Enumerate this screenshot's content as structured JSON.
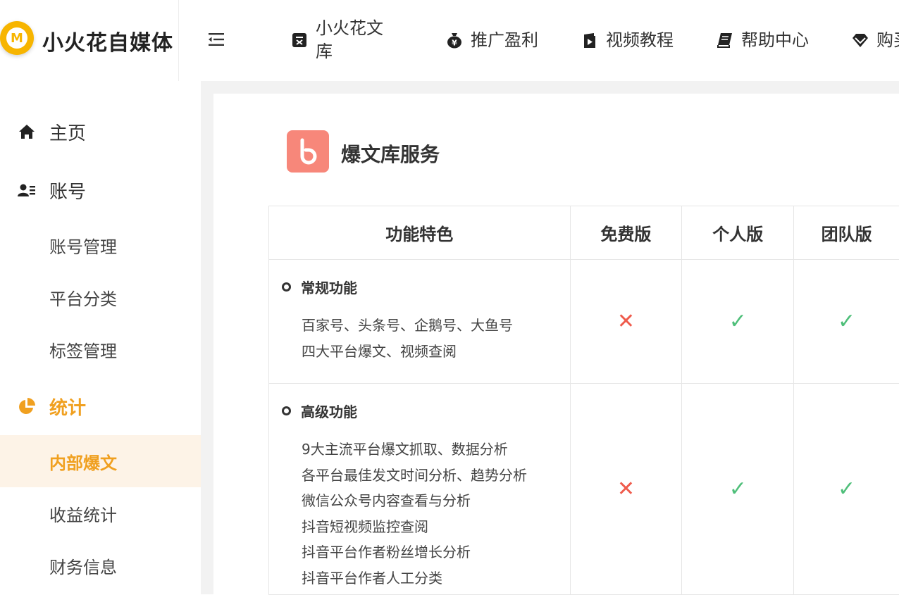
{
  "brand": {
    "name": "小火花自媒体",
    "logo_letter": "M",
    "accent": "#f7b500"
  },
  "top_nav": [
    {
      "label": "小火花文库",
      "icon": "document-icon"
    },
    {
      "label": "推广盈利",
      "icon": "money-bag-icon"
    },
    {
      "label": "视频教程",
      "icon": "video-book-icon"
    },
    {
      "label": "帮助中心",
      "icon": "book-icon"
    },
    {
      "label": "购买会员",
      "icon": "diamond-icon"
    }
  ],
  "sidebar": {
    "home": {
      "label": "主页"
    },
    "account": {
      "label": "账号"
    },
    "account_items": [
      "账号管理",
      "平台分类",
      "标签管理"
    ],
    "stats": {
      "label": "统计"
    },
    "stats_items": [
      "内部爆文",
      "收益统计",
      "财务信息"
    ],
    "active_item": "内部爆文",
    "accent": "#f0a020"
  },
  "service": {
    "title": "爆文库服务",
    "logo_letter": "b",
    "logo_color": "#f7877a"
  },
  "feature_table": {
    "headers": {
      "feature": "功能特色",
      "free": "免费版",
      "personal": "个人版",
      "team": "团队版"
    },
    "rows": [
      {
        "title": "常规功能",
        "lines": [
          "百家号、头条号、企鹅号、大鱼号",
          "四大平台爆文、视频查阅"
        ],
        "free": "✕",
        "personal": "✓",
        "team": "✓"
      },
      {
        "title": "高级功能",
        "lines": [
          "9大主流平台爆文抓取、数据分析",
          "各平台最佳发文时间分析、趋势分析",
          "微信公众号内容查看与分析",
          "抖音短视频监控查阅",
          "抖音平台作者粉丝增长分析",
          "抖音平台作者人工分类"
        ],
        "free": "✕",
        "personal": "✓",
        "team": "✓"
      }
    ]
  },
  "colors": {
    "yes": "#4fbf7a",
    "no": "#ef5b4c"
  }
}
